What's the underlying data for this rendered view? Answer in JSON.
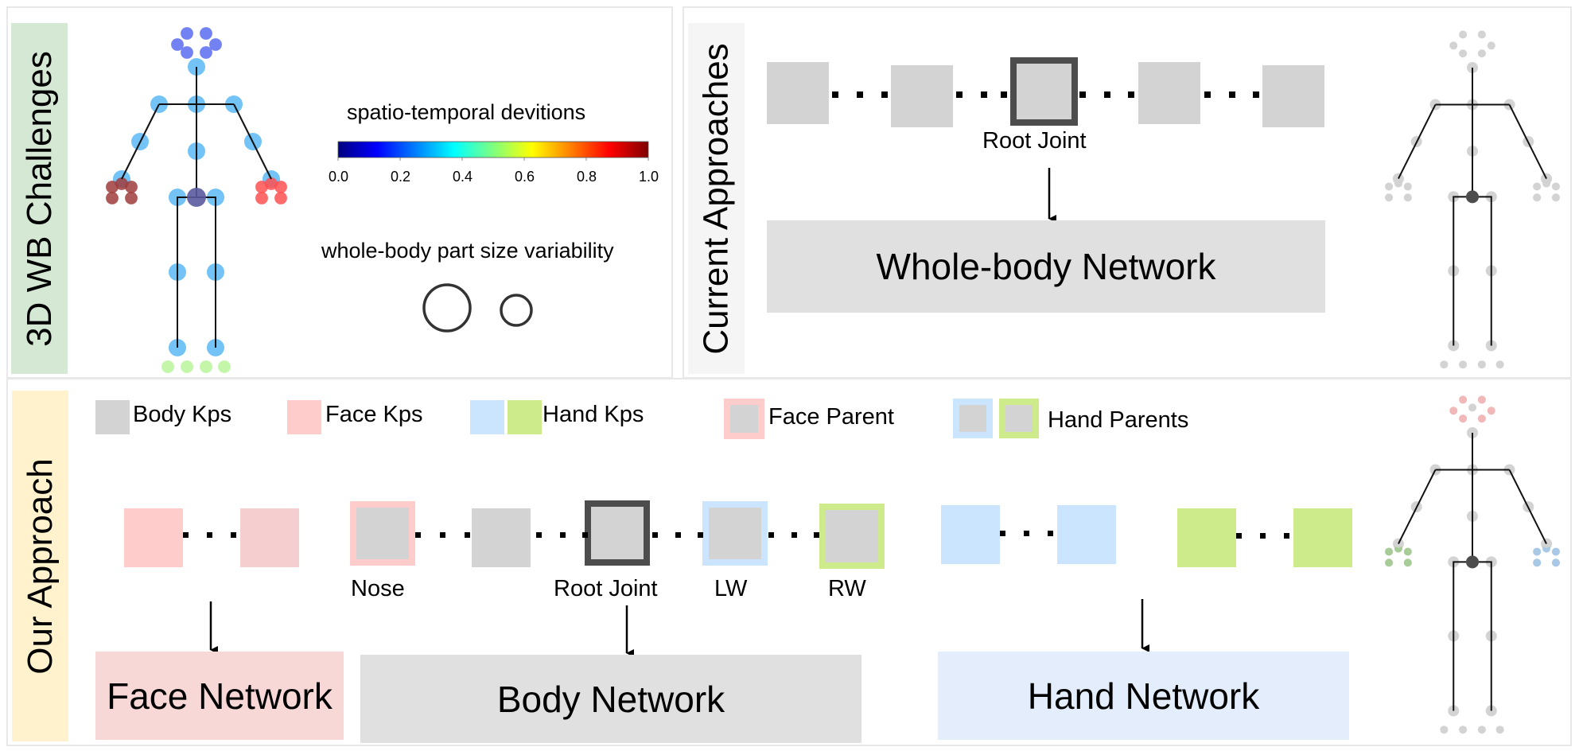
{
  "panels": {
    "challenges": {
      "label": "3D WB Challenges",
      "label_bg": "#d5e8d4",
      "colorbar": {
        "title": "spatio-temporal devitions",
        "colormap": "jet",
        "ticks": [
          "0.0",
          "0.2",
          "0.4",
          "0.6",
          "0.8",
          "1.0"
        ],
        "range": [
          0.0,
          1.0
        ]
      },
      "size_variability": {
        "title": "whole-body part size variability",
        "circles": [
          "large-circle",
          "small-circle"
        ]
      },
      "skeleton_colors": {
        "body": "#5ab8f5",
        "face": "#5a6cf0",
        "left_hand": "#a03c3c",
        "right_hand": "#ff5050",
        "feet": "#b8f59a",
        "root": "#5a5aa0"
      }
    },
    "current": {
      "label": "Current Approaches",
      "label_bg": "#f5f5f5",
      "root_label": "Root Joint",
      "network_label": "Whole-body Network",
      "network_color": "#e0e0e0"
    },
    "ours": {
      "label": "Our Approach",
      "label_bg": "#fff2cc",
      "legend": [
        {
          "label": "Body Kps",
          "swatches": [
            "#d3d3d3"
          ]
        },
        {
          "label": "Face Kps",
          "swatches": [
            "#ffcccc"
          ]
        },
        {
          "label": "Hand Kps",
          "swatches": [
            "#cce5ff",
            "#cdeb8b"
          ]
        },
        {
          "label": "Face Parent",
          "swatches": [
            "#ffcccc"
          ]
        },
        {
          "label": "Hand Parents",
          "swatches": [
            "#cce5ff",
            "#cdeb8b"
          ]
        }
      ],
      "joint_labels": {
        "nose": "Nose",
        "root": "Root Joint",
        "lw": "LW",
        "rw": "RW"
      },
      "networks": {
        "face": {
          "label": "Face Network",
          "color": "#f8d7d7"
        },
        "body": {
          "label": "Body Network",
          "color": "#e0e0e0"
        },
        "hand": {
          "label": "Hand Network",
          "color": "#e3edfb"
        }
      },
      "skeleton_colors": {
        "body": "#d3d3d3",
        "face": "#f0b8b8",
        "left_hand": "#a8cc98",
        "right_hand": "#a8c8e6",
        "root": "#4d4d4d"
      }
    }
  }
}
